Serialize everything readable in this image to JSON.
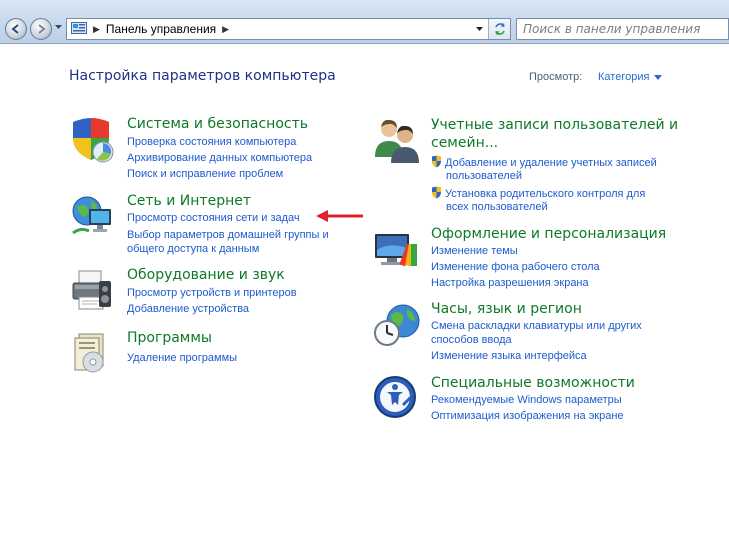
{
  "address_bar": {
    "crumb": "Панель управления",
    "search_placeholder": "Поиск в панели управления"
  },
  "header": {
    "title": "Настройка параметров компьютера",
    "view_label": "Просмотр:",
    "view_value": "Категория"
  },
  "categories": {
    "system": {
      "title": "Система и безопасность",
      "links": [
        "Проверка состояния компьютера",
        "Архивирование данных компьютера",
        "Поиск и исправление проблем"
      ]
    },
    "network": {
      "title": "Сеть и Интернет",
      "links": [
        "Просмотр состояния сети и задач",
        "Выбор параметров домашней группы и",
        "общего доступа к данным"
      ]
    },
    "hardware": {
      "title": "Оборудование и звук",
      "links": [
        "Просмотр устройств и принтеров",
        "Добавление устройства"
      ]
    },
    "programs": {
      "title": "Программы",
      "links": [
        "Удаление программы"
      ]
    },
    "users": {
      "title_line1": "Учетные записи пользователей и",
      "title_line2": "семейн...",
      "links": [
        "Добавление и удаление учетных записей",
        "пользователей",
        "Установка родительского контроля для",
        "всех пользователей"
      ]
    },
    "appearance": {
      "title": "Оформление и персонализация",
      "links": [
        "Изменение темы",
        "Изменение фона рабочего стола",
        "Настройка разрешения экрана"
      ]
    },
    "clock": {
      "title": "Часы, язык и регион",
      "links": [
        "Смена раскладки клавиатуры или других",
        "способов ввода",
        "Изменение языка интерфейса"
      ]
    },
    "access": {
      "title": "Специальные возможности",
      "links": [
        "Рекомендуемые Windows параметры",
        "Оптимизация изображения на экране"
      ]
    }
  },
  "colors": {
    "category_title": "#0e7a28",
    "link": "#1e5bcf",
    "annotation_arrow": "#e0202a"
  }
}
